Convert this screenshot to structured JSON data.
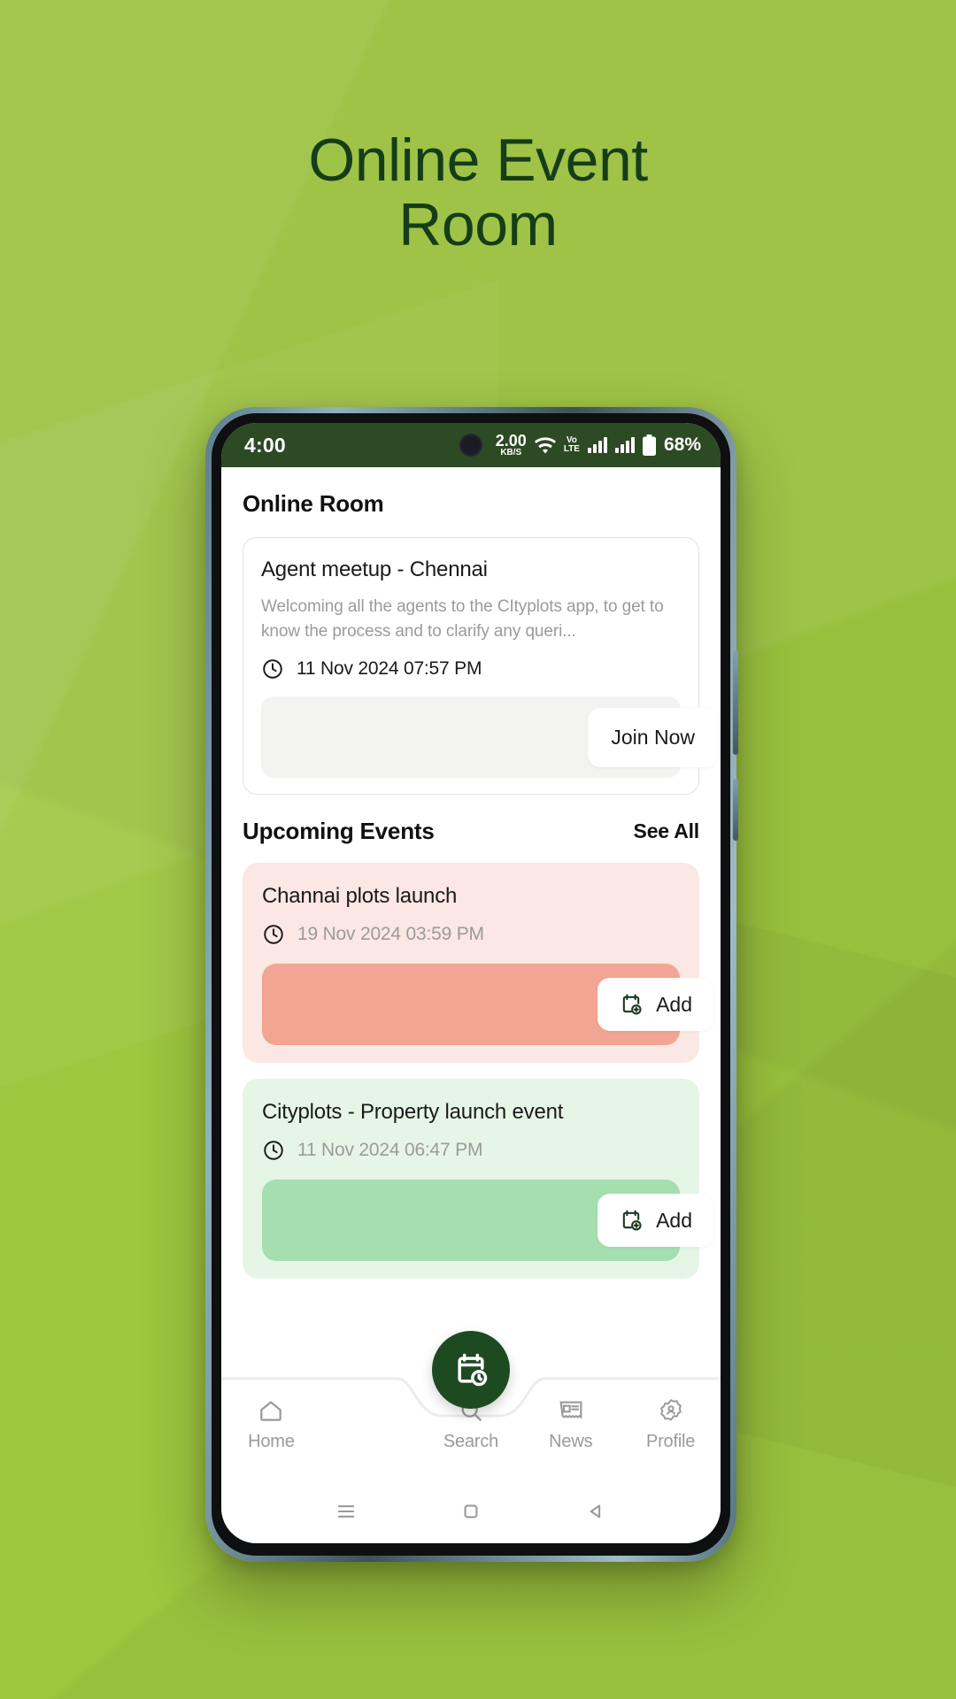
{
  "promo": {
    "title": "Online Event\nRoom",
    "background_color": "#9ec63f",
    "title_color": "#163d18"
  },
  "phone": {
    "status_bar": {
      "time": "4:00",
      "net_speed_value": "2.00",
      "net_speed_unit": "KB/S",
      "volte_top": "Vo",
      "volte_bottom": "LTE",
      "battery": "68%",
      "background_color": "#2c4a23",
      "icons": [
        "camera-punch-hole",
        "wifi-icon",
        "volte-icon",
        "signal-bars-icon",
        "signal-bars-icon",
        "battery-icon"
      ]
    },
    "app": {
      "screen_title": "Online Room",
      "live_room": {
        "name": "Agent meetup - Chennai",
        "description": "Welcoming all the agents to the CItyplots app, to get to know the process and to clarify any queri...",
        "time": "11 Nov 2024 07:57 PM",
        "clock_icon": "clock-icon",
        "join_label": "Join Now"
      },
      "upcoming": {
        "heading": "Upcoming Events",
        "see_all_label": "See All",
        "events": [
          {
            "name": "Channai plots launch",
            "time": "19 Nov 2024 03:59 PM",
            "clock_icon": "clock-icon",
            "add_label": "Add",
            "add_icon": "calendar-add-icon",
            "card_color": "#fbe7e3",
            "action_color": "#f2a593"
          },
          {
            "name": "Cityplots - Property launch event",
            "time": "11 Nov 2024 06:47 PM",
            "clock_icon": "clock-icon",
            "add_label": "Add",
            "add_icon": "calendar-add-icon",
            "card_color": "#e6f6e6",
            "action_color": "#a5dfb0"
          }
        ]
      },
      "bottom_nav": {
        "fab_icon": "calendar-clock-icon",
        "fab_color": "#1e4a22",
        "items": [
          {
            "label": "Home",
            "icon": "home-icon"
          },
          {
            "label": "Search",
            "icon": "search-icon"
          },
          {
            "label": "News",
            "icon": "news-icon"
          },
          {
            "label": "Profile",
            "icon": "gear-person-icon"
          }
        ]
      }
    },
    "system_nav": {
      "recents_icon": "menu-lines-icon",
      "home_icon": "square-icon",
      "back_icon": "triangle-back-icon"
    }
  }
}
